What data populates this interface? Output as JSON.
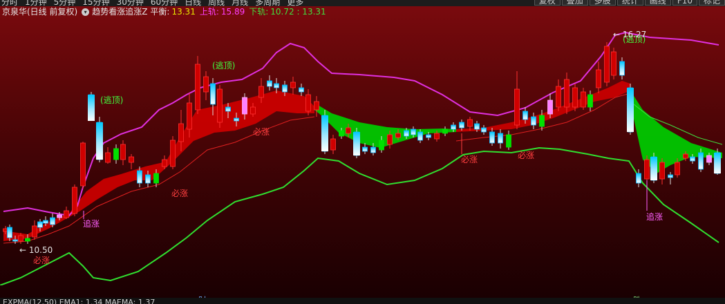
{
  "toolbar": {
    "periods": [
      "分时",
      "1分钟",
      "5分钟",
      "15分钟",
      "30分钟",
      "60分钟",
      "日线",
      "周线",
      "月线",
      "多周期",
      "更多"
    ],
    "right_buttons": [
      "复权",
      "叠加",
      "多股",
      "统计",
      "画线",
      "F10",
      "标记"
    ]
  },
  "info": {
    "stock": "京泉华(日线 前复权)",
    "indicator": "趋势看涨追涨Z",
    "ping_label": "平衡:",
    "ping_value": "13.31",
    "upper_label": "上轨:",
    "upper_value": "15.89",
    "lower_label": "下轨:",
    "lower_value": "10.72 : 13.31"
  },
  "annotations": {
    "low_price": "10.50",
    "high_price": "16.27",
    "escape_top": "(逃顶)",
    "must_rise": "必涨",
    "chase_rise": "追涨"
  },
  "axis": {
    "mark_cai": "财",
    "mark_die": "跌"
  },
  "bottom": {
    "text": "EXPMA(12,50) EMA1: 1.34 MAEMA: 1.37"
  },
  "colors": {
    "upper_band": "#e030e0",
    "lower_band": "#30e030",
    "red_fill": "#d00000",
    "green_fill": "#00c800",
    "candle_cyan": "#00b4ff",
    "candle_white": "#ffffff",
    "candle_pink": "#ff80ff"
  }
}
